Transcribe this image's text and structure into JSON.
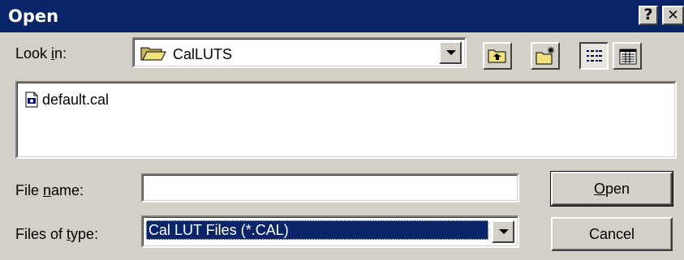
{
  "window": {
    "title": "Open",
    "help_label": "?",
    "close_label": "✕"
  },
  "look_in": {
    "label_prefix": "Look ",
    "label_accel": "i",
    "label_suffix": "n:",
    "value": "CalLUTS",
    "icon": "folder-open-icon"
  },
  "toolbar": {
    "up_icon": "up-one-level-icon",
    "new_folder_icon": "new-folder-icon",
    "list_icon": "list-view-icon",
    "details_icon": "details-view-icon"
  },
  "file_list": {
    "items": [
      {
        "name": "default.cal",
        "icon": "cal-file-icon"
      }
    ]
  },
  "file_name": {
    "label_prefix": "File ",
    "label_accel": "n",
    "label_suffix": "ame:",
    "value": ""
  },
  "file_type": {
    "label_prefix": "Files of ",
    "label_accel": "t",
    "label_suffix": "ype:",
    "value": "Cal LUT Files (*.CAL)"
  },
  "buttons": {
    "open_accel": "O",
    "open_rest": "pen",
    "cancel": "Cancel"
  },
  "colors": {
    "titlebar": "#0a246a",
    "face": "#d4d0c8",
    "selection": "#0a246a"
  }
}
